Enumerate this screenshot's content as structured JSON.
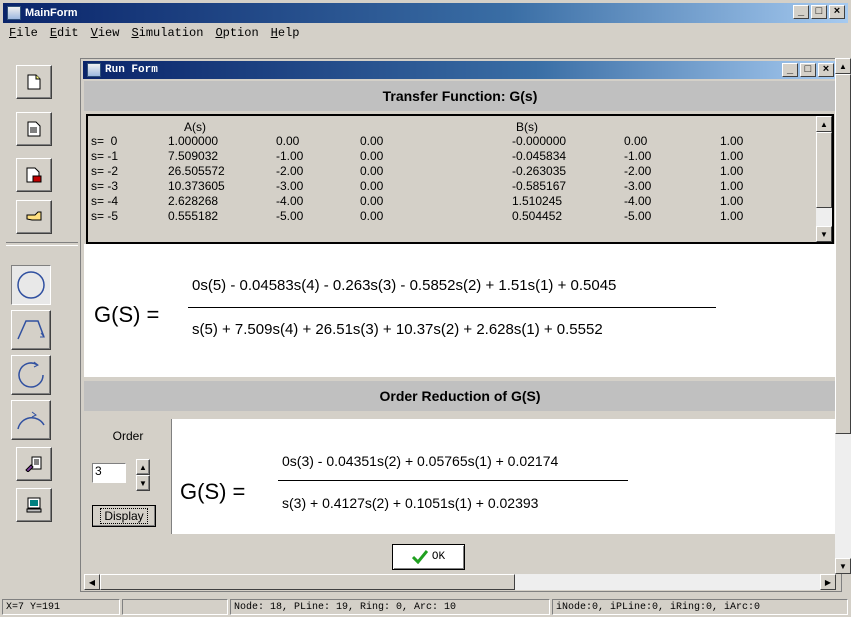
{
  "main_window": {
    "title": "MainForm",
    "controls": [
      "_",
      "□",
      "×"
    ]
  },
  "menu": [
    "File",
    "Edit",
    "View",
    "Simulation",
    "Option",
    "Help"
  ],
  "toolbar": {
    "buttons": [
      "new-file-icon",
      "open-file-icon",
      "save-file-icon",
      "pointer-hand-icon"
    ],
    "tools": [
      "circle-tool-icon",
      "polyline-tool-icon",
      "ring-tool-icon",
      "arc-tool-icon",
      "node-edit-tool-icon",
      "monitor-tool-icon"
    ]
  },
  "run_form": {
    "title": "Run Form",
    "controls": [
      "_",
      "□",
      "×"
    ],
    "tf_header": "Transfer Function:  G(s)",
    "grid": {
      "a_header": "A(s)",
      "b_header": "B(s)",
      "rows": [
        {
          "s": "s=  0",
          "a": "1.000000",
          "a2": "0.00",
          "a3": "0.00",
          "b": "-0.000000",
          "b2": "0.00",
          "b3": "1.00"
        },
        {
          "s": "s= -1",
          "a": "7.509032",
          "a2": "-1.00",
          "a3": "0.00",
          "b": "-0.045834",
          "b2": "-1.00",
          "b3": "1.00"
        },
        {
          "s": "s= -2",
          "a": "26.505572",
          "a2": "-2.00",
          "a3": "0.00",
          "b": "-0.263035",
          "b2": "-2.00",
          "b3": "1.00"
        },
        {
          "s": "s= -3",
          "a": "10.373605",
          "a2": "-3.00",
          "a3": "0.00",
          "b": "-0.585167",
          "b2": "-3.00",
          "b3": "1.00"
        },
        {
          "s": "s= -4",
          "a": "2.628268",
          "a2": "-4.00",
          "a3": "0.00",
          "b": "1.510245",
          "b2": "-4.00",
          "b3": "1.00"
        },
        {
          "s": "s= -5",
          "a": "0.555182",
          "a2": "-5.00",
          "a3": "0.00",
          "b": "0.504452",
          "b2": "-5.00",
          "b3": "1.00"
        }
      ]
    },
    "full_tf": {
      "label": "G(S) =",
      "numerator": "0s(5)  - 0.04583s(4)  - 0.263s(3)  - 0.5852s(2)  + 1.51s(1)  + 0.5045",
      "denominator": "s(5)  + 7.509s(4)  + 26.51s(3)  + 10.37s(2)  + 2.628s(1)  + 0.5552"
    },
    "reduction_header": "Order Reduction of G(S)",
    "order": {
      "label": "Order",
      "value": "3",
      "display_button": "Display"
    },
    "reduced_tf": {
      "label": "G(S) =",
      "numerator": "0s(3)  - 0.04351s(2)  + 0.05765s(1)  + 0.02174",
      "denominator": "s(3)  + 0.4127s(2)  + 0.1051s(1)  + 0.02393"
    },
    "ok_button": "OK"
  },
  "status": {
    "coords": "X=7 Y=191",
    "counts": "Node: 18, PLine: 19, Ring: 0, Arc: 10",
    "indices": "iNode:0, iPLine:0, iRing:0, iArc:0"
  }
}
